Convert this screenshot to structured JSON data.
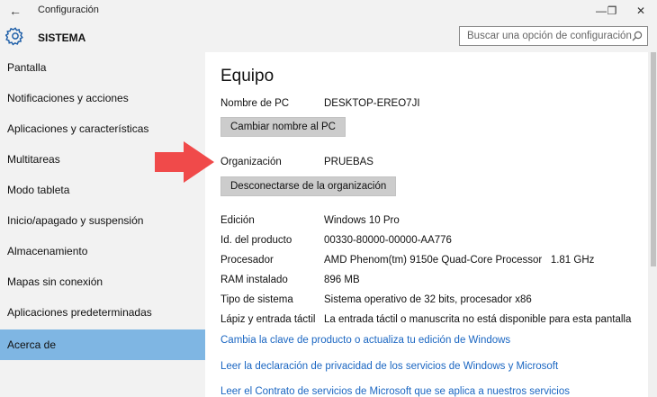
{
  "window": {
    "title": "Configuración",
    "back_icon": "←",
    "minimize_icon": "—",
    "maximize_icon": "❐",
    "close_icon": "✕"
  },
  "header": {
    "section": "SISTEMA",
    "search_placeholder": "Buscar una opción de configuración"
  },
  "sidebar": {
    "items": [
      {
        "label": "Pantalla"
      },
      {
        "label": "Notificaciones y acciones"
      },
      {
        "label": "Aplicaciones y características"
      },
      {
        "label": "Multitareas"
      },
      {
        "label": "Modo tableta"
      },
      {
        "label": "Inicio/apagado y suspensión"
      },
      {
        "label": "Almacenamiento"
      },
      {
        "label": "Mapas sin conexión"
      },
      {
        "label": "Aplicaciones predeterminadas"
      },
      {
        "label": "Acerca de",
        "selected": true
      }
    ]
  },
  "main": {
    "title": "Equipo",
    "pc_name": {
      "label": "Nombre de PC",
      "value": "DESKTOP-EREO7JI"
    },
    "rename_button": "Cambiar nombre al PC",
    "organization": {
      "label": "Organización",
      "value": "PRUEBAS"
    },
    "disconnect_button": "Desconectarse de la organización",
    "specs": [
      {
        "label": "Edición",
        "value": "Windows 10 Pro"
      },
      {
        "label": "Id. del producto",
        "value": "00330-80000-00000-AA776"
      },
      {
        "label": "Procesador",
        "value": "AMD Phenom(tm) 9150e Quad-Core Processor   1.81 GHz"
      },
      {
        "label": "RAM instalado",
        "value": "896 MB"
      },
      {
        "label": "Tipo de sistema",
        "value": "Sistema operativo de 32 bits, procesador x86"
      },
      {
        "label": "Lápiz y entrada táctil",
        "value": "La entrada táctil o manuscrita no está disponible para esta pantalla"
      }
    ],
    "links": [
      "Cambia la clave de producto o actualiza tu edición de Windows",
      "Leer la declaración de privacidad de los servicios de Windows y Microsoft",
      "Leer el Contrato de servicios de Microsoft que se aplica a nuestros servicios"
    ]
  },
  "colors": {
    "selected_nav": "#7fb6e3",
    "link": "#1a66c2",
    "arrow": "#f04a4a"
  }
}
